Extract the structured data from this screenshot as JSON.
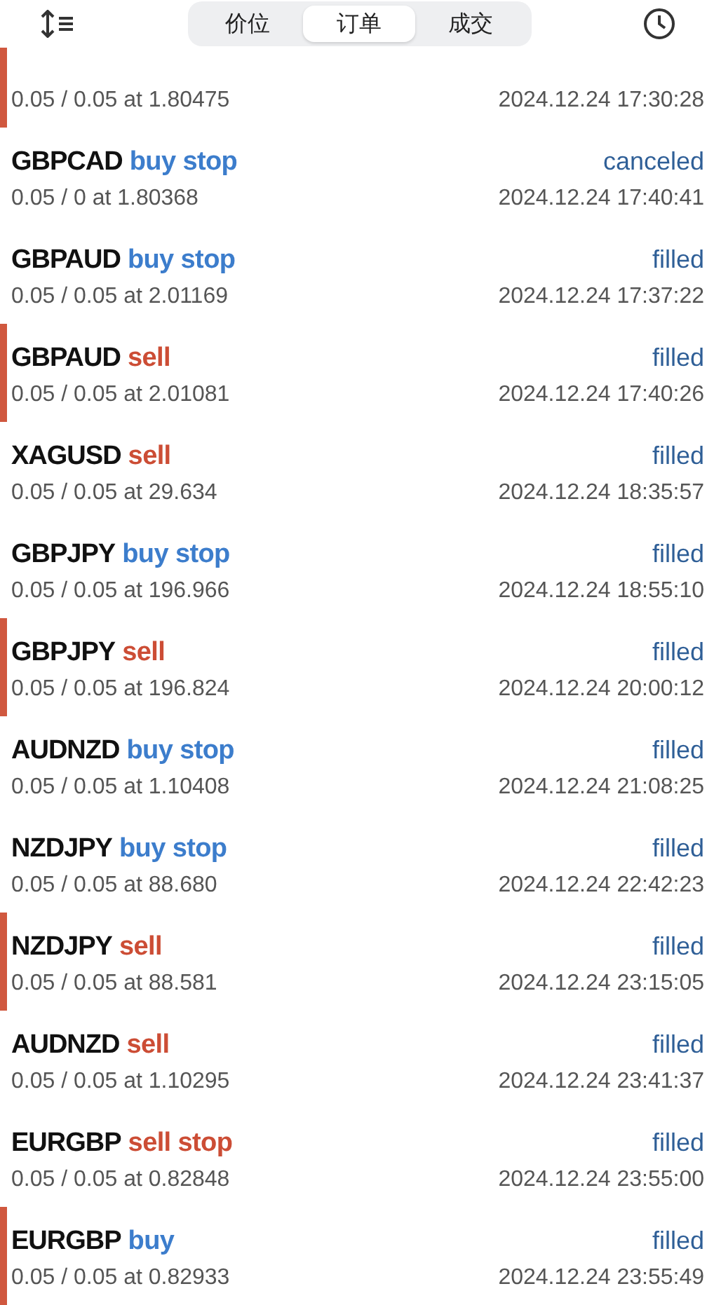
{
  "header": {
    "tabs": [
      {
        "label": "价位",
        "selected": false
      },
      {
        "label": "订单",
        "selected": true
      },
      {
        "label": "成交",
        "selected": false
      }
    ]
  },
  "orders": [
    {
      "marked": true,
      "detail": "0.05 / 0.05 at 1.80475",
      "time": "2024.12.24 17:30:28"
    },
    {
      "marked": false,
      "symbol": "GBPCAD",
      "side": "buy stop",
      "kind": "buy",
      "status": "canceled",
      "detail": "0.05 / 0 at 1.80368",
      "time": "2024.12.24 17:40:41"
    },
    {
      "marked": false,
      "symbol": "GBPAUD",
      "side": "buy stop",
      "kind": "buy",
      "status": "filled",
      "detail": "0.05 / 0.05 at 2.01169",
      "time": "2024.12.24 17:37:22"
    },
    {
      "marked": true,
      "symbol": "GBPAUD",
      "side": "sell",
      "kind": "sell",
      "status": "filled",
      "detail": "0.05 / 0.05 at 2.01081",
      "time": "2024.12.24 17:40:26"
    },
    {
      "marked": false,
      "symbol": "XAGUSD",
      "side": "sell",
      "kind": "sell",
      "status": "filled",
      "detail": "0.05 / 0.05 at 29.634",
      "time": "2024.12.24 18:35:57"
    },
    {
      "marked": false,
      "symbol": "GBPJPY",
      "side": "buy stop",
      "kind": "buy",
      "status": "filled",
      "detail": "0.05 / 0.05 at 196.966",
      "time": "2024.12.24 18:55:10"
    },
    {
      "marked": true,
      "symbol": "GBPJPY",
      "side": "sell",
      "kind": "sell",
      "status": "filled",
      "detail": "0.05 / 0.05 at 196.824",
      "time": "2024.12.24 20:00:12"
    },
    {
      "marked": false,
      "symbol": "AUDNZD",
      "side": "buy stop",
      "kind": "buy",
      "status": "filled",
      "detail": "0.05 / 0.05 at 1.10408",
      "time": "2024.12.24 21:08:25"
    },
    {
      "marked": false,
      "symbol": "NZDJPY",
      "side": "buy stop",
      "kind": "buy",
      "status": "filled",
      "detail": "0.05 / 0.05 at 88.680",
      "time": "2024.12.24 22:42:23"
    },
    {
      "marked": true,
      "symbol": "NZDJPY",
      "side": "sell",
      "kind": "sell",
      "status": "filled",
      "detail": "0.05 / 0.05 at 88.581",
      "time": "2024.12.24 23:15:05"
    },
    {
      "marked": false,
      "symbol": "AUDNZD",
      "side": "sell",
      "kind": "sell",
      "status": "filled",
      "detail": "0.05 / 0.05 at 1.10295",
      "time": "2024.12.24 23:41:37"
    },
    {
      "marked": false,
      "symbol": "EURGBP",
      "side": "sell stop",
      "kind": "sell",
      "status": "filled",
      "detail": "0.05 / 0.05 at 0.82848",
      "time": "2024.12.24 23:55:00"
    },
    {
      "marked": true,
      "symbol": "EURGBP",
      "side": "buy",
      "kind": "buy",
      "status": "filled",
      "detail": "0.05 / 0.05 at 0.82933",
      "time": "2024.12.24 23:55:49"
    }
  ]
}
